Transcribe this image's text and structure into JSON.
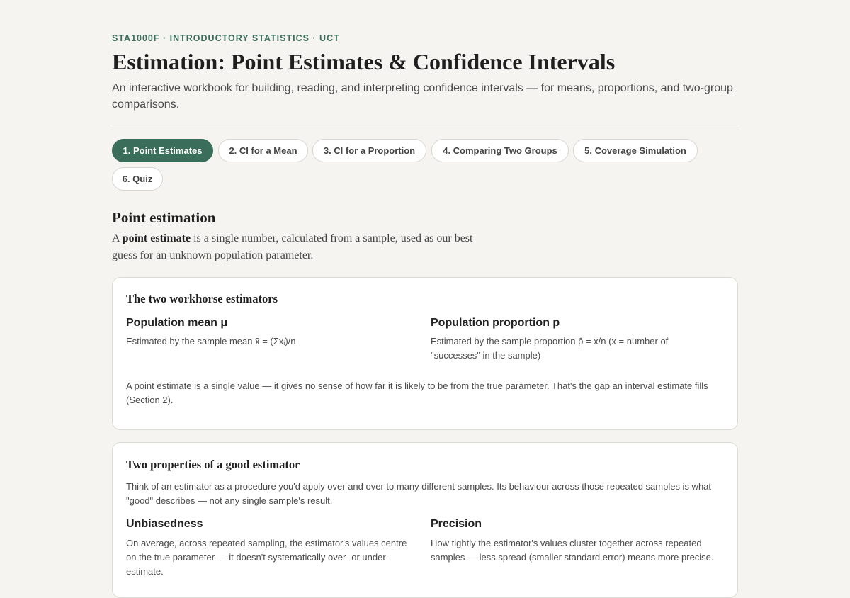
{
  "header": {
    "course": "STA1000F · INTRODUCTORY STATISTICS · UCT",
    "title": "Estimation: Point Estimates & Confidence Intervals",
    "subtitle": "An interactive workbook for building, reading, and interpreting confidence intervals — for means, proportions, and two-group comparisons."
  },
  "tabs": [
    {
      "label": "1. Point Estimates",
      "active": true
    },
    {
      "label": "2. CI for a Mean",
      "active": false
    },
    {
      "label": "3. CI for a Proportion",
      "active": false
    },
    {
      "label": "4. Comparing Two Groups",
      "active": false
    },
    {
      "label": "5. Coverage Simulation",
      "active": false
    },
    {
      "label": "6. Quiz",
      "active": false
    }
  ],
  "section": {
    "heading": "Point estimation",
    "intro_prefix": "A ",
    "intro_bold": "point estimate",
    "intro_suffix": " is a single number, calculated from a sample, used as our best guess for an unknown population parameter."
  },
  "card1": {
    "title": "The two workhorse estimators",
    "left_heading": "Population mean μ",
    "left_text": "Estimated by the sample mean x̄ = (Σxᵢ)/n",
    "right_heading": "Population proportion p",
    "right_text": "Estimated by the sample proportion p̂ = x/n (x = number of \"successes\" in the sample)",
    "note": "A point estimate is a single value — it gives no sense of how far it is likely to be from the true parameter. That's the gap an interval estimate fills (Section 2)."
  },
  "card2": {
    "title": "Two properties of a good estimator",
    "intro": "Think of an estimator as a procedure you'd apply over and over to many different samples. Its behaviour across those repeated samples is what \"good\" describes — not any single sample's result.",
    "left_heading": "Unbiasedness",
    "left_text": "On average, across repeated sampling, the estimator's values centre on the true parameter — it doesn't systematically over- or under-estimate.",
    "right_heading": "Precision",
    "right_text": "How tightly the estimator's values cluster together across repeated samples — less spread (smaller standard error) means more precise."
  },
  "colors": {
    "accent": "#3b6e5a",
    "background": "#f5f4f0",
    "card": "#ffffff"
  }
}
